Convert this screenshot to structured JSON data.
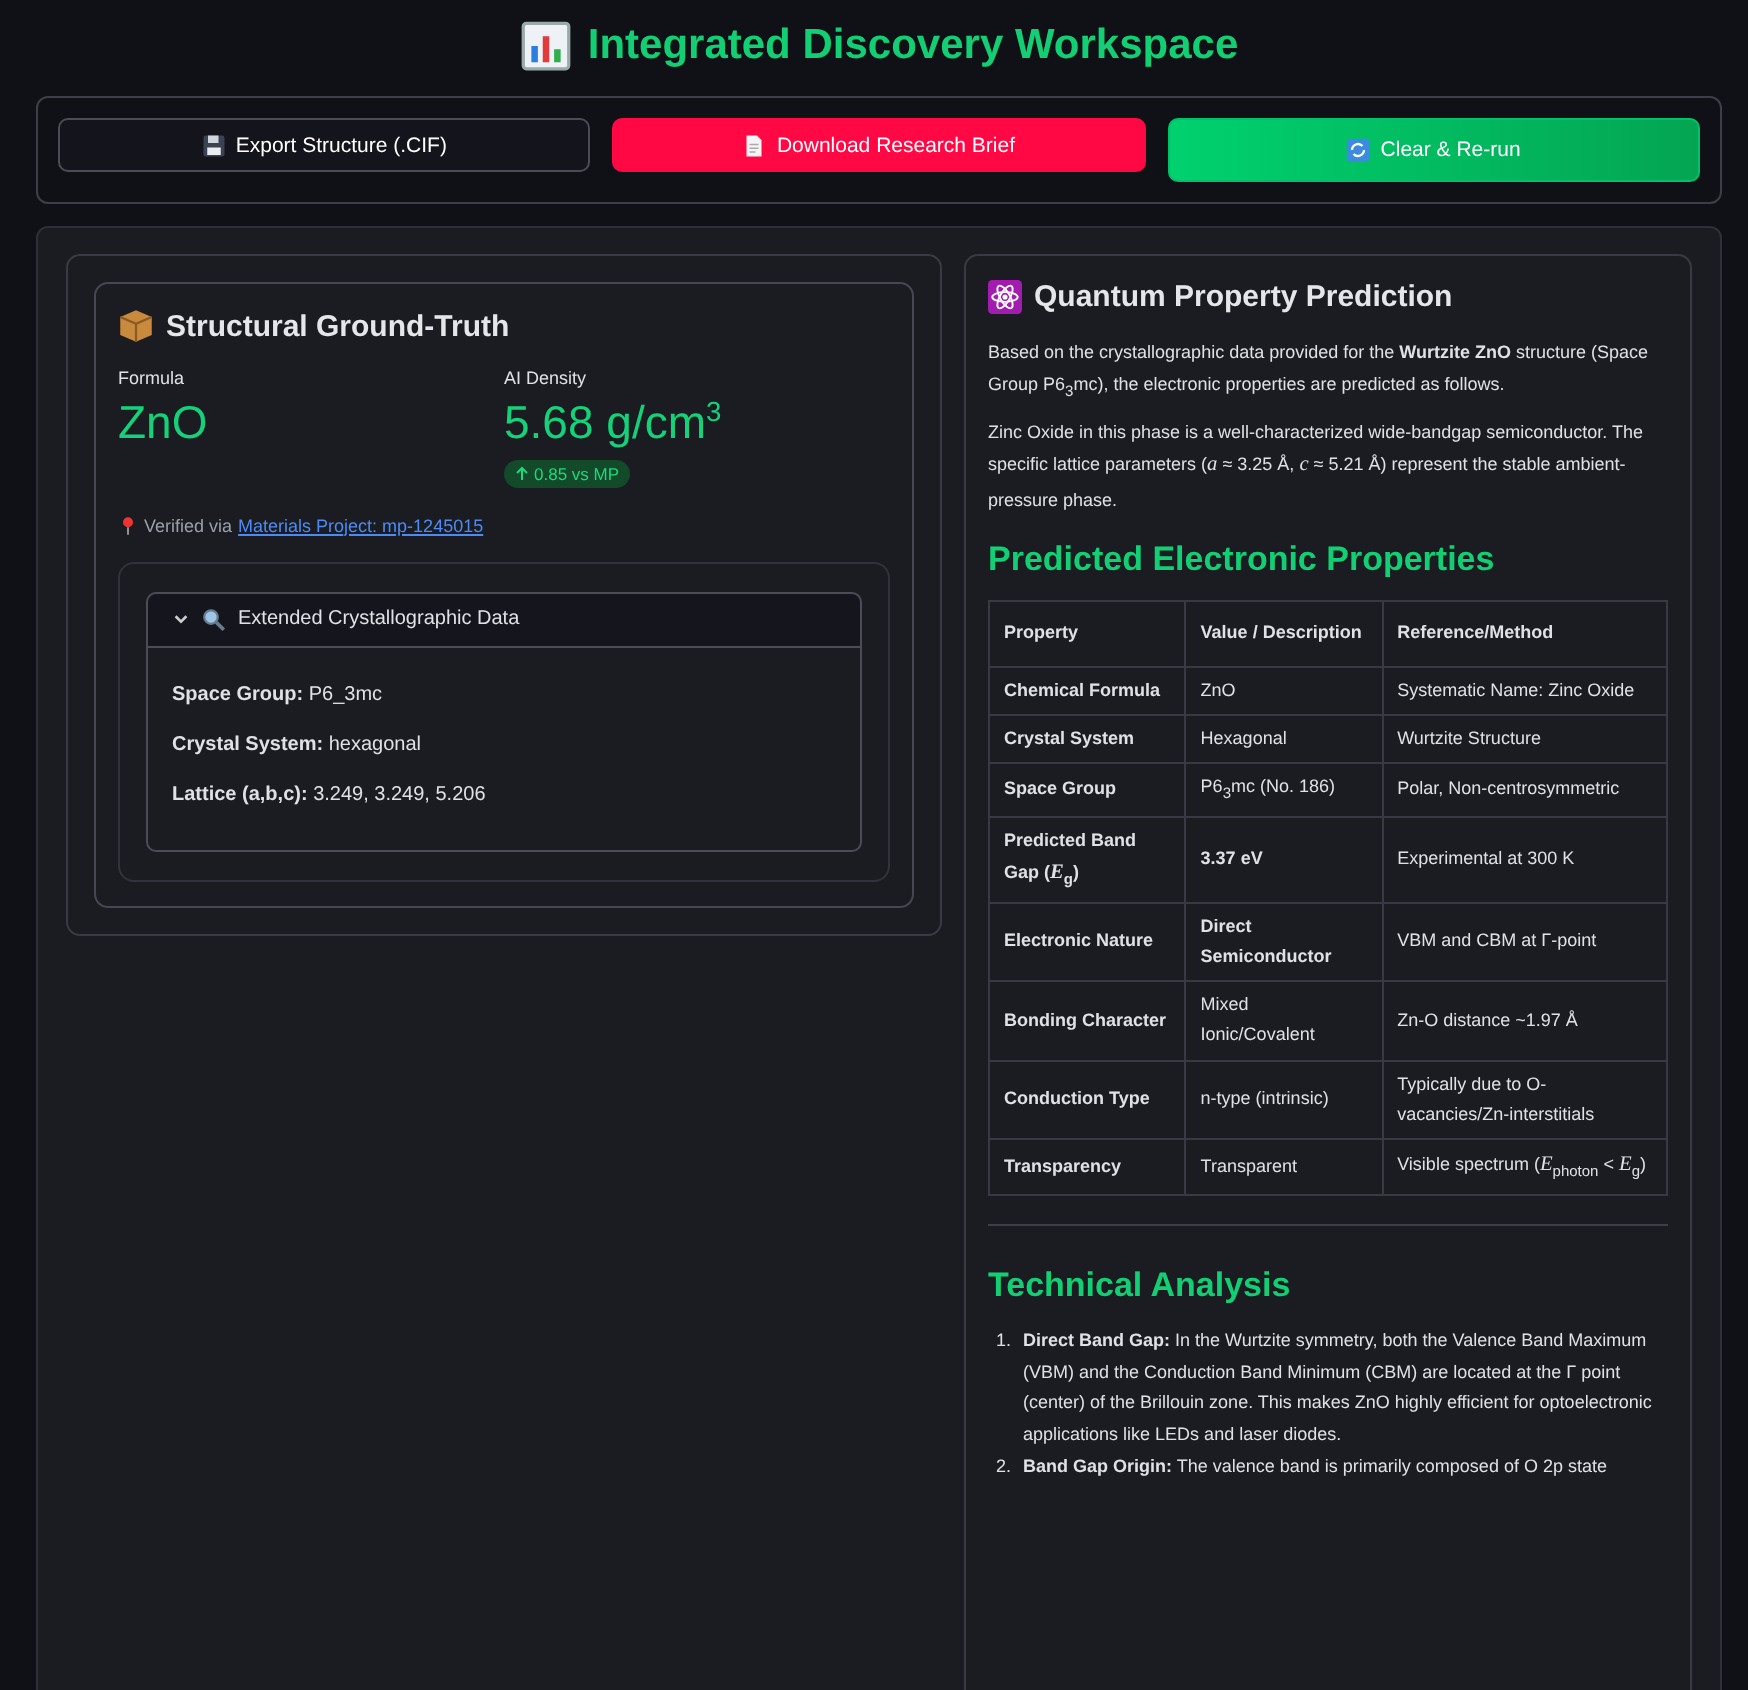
{
  "title": "Integrated Discovery Workspace",
  "toolbar": [
    {
      "label": "Export Structure (.CIF)",
      "kind": "secondary"
    },
    {
      "label": "Download Research Brief",
      "kind": "danger"
    },
    {
      "label": "Clear & Re-run",
      "kind": "primary"
    }
  ],
  "structure": {
    "title": "Structural Ground-Truth",
    "metrics": [
      {
        "label": "Formula",
        "value": "ZnO"
      },
      {
        "label": "AI Density",
        "value": "5.68 g/cm$^{3}$",
        "delta": "0.85 vs MP"
      }
    ],
    "verified": {
      "text": "Verified via",
      "link": "Materials Project: mp-1245015"
    },
    "expander": {
      "title": "Extended Crystallographic Data",
      "expanded": true,
      "lines": [
        "**Space Group:** P6_3mc",
        "**Crystal System:** hexagonal",
        "**Lattice (a,b,c):** 3.249, 3.249, 5.206"
      ]
    }
  },
  "prediction": {
    "title": "Quantum Property Prediction",
    "paragraphs": [
      "Based on the crystallographic data provided for the **Wurtzite ZnO** structure (Space Group P6$_{3}$mc), the electronic properties are predicted as follows.",
      "Zinc Oxide in this phase is a well-characterized wide-bandgap semiconductor. The specific lattice parameters (*a* ≈ 3.25 Å, *c* ≈ 5.21 Å) represent the stable ambient-pressure phase."
    ],
    "table_title": "Predicted Electronic Properties",
    "table": {
      "columns": [
        "Property",
        "Value / Description",
        "Reference/Method"
      ],
      "rows": [
        [
          "Chemical Formula",
          "ZnO",
          "Systematic Name: Zinc Oxide"
        ],
        [
          "Crystal System",
          "Hexagonal",
          "Wurtzite Structure"
        ],
        [
          "Space Group",
          "P6$_{3}$mc (No. 186)",
          "Polar, Non-centrosymmetric"
        ],
        [
          "Predicted Band Gap (*E*$_{g}$)",
          "**3.37 eV**",
          "Experimental at 300 K"
        ],
        [
          "Electronic Nature",
          "**Direct Semiconductor**",
          "VBM and CBM at Γ-point"
        ],
        [
          "Bonding Character",
          "Mixed Ionic/Covalent",
          "Zn-O distance ~1.97 Å"
        ],
        [
          "Conduction Type",
          "n-type (intrinsic)",
          "Typically due to O-vacancies/Zn-interstitials"
        ],
        [
          "Transparency",
          "Transparent",
          "Visible spectrum (*E*$_{photon}$ < *E*$_{g}$)"
        ]
      ]
    },
    "analysis_title": "Technical Analysis",
    "analysis": [
      {
        "number": "1.",
        "text": "**Direct Band Gap:** In the Wurtzite symmetry, both the Valence Band Maximum (VBM) and the Conduction Band Minimum (CBM) are located at the Γ point (center) of the Brillouin zone. This makes ZnO highly efficient for optoelectronic applications like LEDs and laser diodes."
      },
      {
        "number": "2.",
        "text": "**Band Gap Origin:** The valence band is primarily composed of O 2p state"
      }
    ]
  }
}
